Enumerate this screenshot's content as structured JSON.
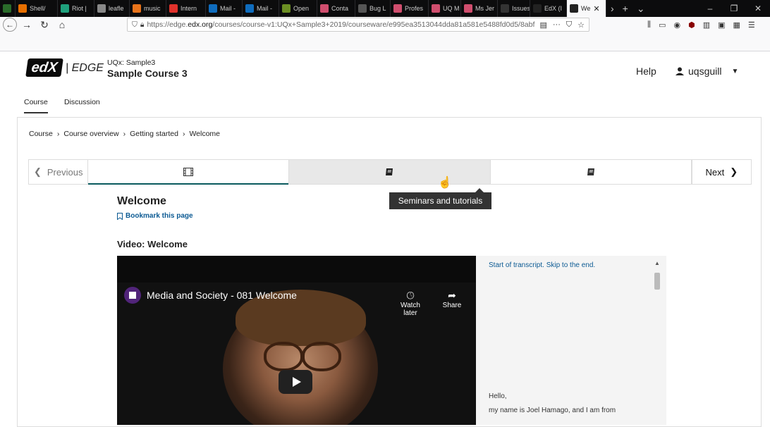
{
  "browser": {
    "tabs": [
      {
        "label": "",
        "icon": "synaptic-icon",
        "color": "#2a6b2a"
      },
      {
        "label": "Shell/",
        "icon": "shell-icon",
        "color": "#e76f00"
      },
      {
        "label": "Riot |",
        "icon": "riot-icon",
        "color": "#1fa07c"
      },
      {
        "label": "leafle",
        "icon": "leaflet-icon",
        "color": "#888"
      },
      {
        "label": "music",
        "icon": "music-icon",
        "color": "#e8731a"
      },
      {
        "label": "Intern",
        "icon": "diamond-icon",
        "color": "#e0312b"
      },
      {
        "label": "Mail -",
        "icon": "outlook-icon",
        "color": "#0f6cbd"
      },
      {
        "label": "Mail -",
        "icon": "outlook-icon",
        "color": "#0f6cbd"
      },
      {
        "label": "Open",
        "icon": "open-icon",
        "color": "#6b8e23"
      },
      {
        "label": "Conta",
        "icon": "pocket-icon",
        "color": "#d04e6e"
      },
      {
        "label": "Bug L",
        "icon": "bug-icon",
        "color": "#555"
      },
      {
        "label": "Profes",
        "icon": "pocket-icon",
        "color": "#d04e6e"
      },
      {
        "label": "UQ M",
        "icon": "pocket-icon",
        "color": "#d04e6e"
      },
      {
        "label": "Ms Jer",
        "icon": "pocket-icon",
        "color": "#d04e6e"
      },
      {
        "label": "Issues",
        "icon": "issues-icon",
        "color": "#333"
      },
      {
        "label": "EdX (I",
        "icon": "edx-icon",
        "color": "#222"
      },
      {
        "label": "We",
        "icon": "edx-icon",
        "color": "#222"
      }
    ],
    "url_prefix": "https://edge.",
    "url_domain": "edx.org",
    "url_rest": "/courses/course-v1:UQx+Sample3+2019/courseware/e995ea3513044dda81a581e5488fd0d5/8abf"
  },
  "header": {
    "logo_text": "edX",
    "edge_text": "| EDGE",
    "org": "UQx: Sample3",
    "course_title": "Sample Course 3",
    "help": "Help",
    "username": "uqsguill"
  },
  "course_tabs": [
    "Course",
    "Discussion"
  ],
  "breadcrumbs": [
    "Course",
    "Course overview",
    "Getting started",
    "Welcome"
  ],
  "sequence": {
    "previous": "Previous",
    "next": "Next",
    "tooltip": "Seminars and tutorials"
  },
  "unit": {
    "title": "Welcome",
    "bookmark": "Bookmark this page",
    "video_heading": "Video: Welcome"
  },
  "video": {
    "title": "Media and Society - 081 Welcome",
    "watch_later": "Watch later",
    "share": "Share"
  },
  "transcript": {
    "skip": "Start of transcript. Skip to the end.",
    "line1": "Hello,",
    "line2": "my name is Joel Hamago, and I am from"
  }
}
